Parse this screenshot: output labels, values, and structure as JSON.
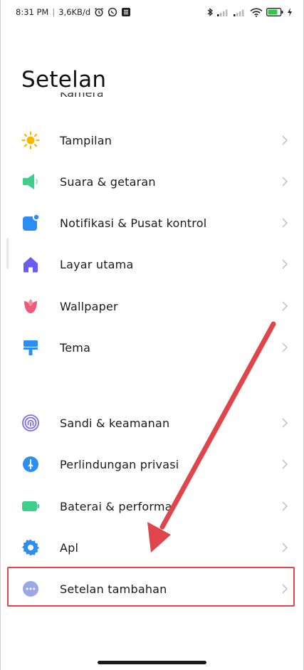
{
  "status_bar": {
    "time": "8:31 PM",
    "separator": "|",
    "speed": "3,6KB/d"
  },
  "header": {
    "title": "Setelan",
    "partial_item": "Kamera"
  },
  "settings_items": [
    {
      "label": "Tampilan",
      "icon": "sun-icon",
      "color": "#f5b800"
    },
    {
      "label": "Suara & getaran",
      "icon": "speaker-icon",
      "color": "#3ccf8e"
    },
    {
      "label": "Notifikasi & Pusat kontrol",
      "icon": "notification-icon",
      "color": "#2b8ef0"
    },
    {
      "label": "Layar utama",
      "icon": "home-icon",
      "color": "#6a5cf0"
    },
    {
      "label": "Wallpaper",
      "icon": "tulip-icon",
      "color": "#ee5a7a"
    },
    {
      "label": "Tema",
      "icon": "brush-icon",
      "color": "#2b8ef0"
    },
    {
      "label": "Sandi & keamanan",
      "icon": "fingerprint-icon",
      "color": "#7a6cf0"
    },
    {
      "label": "Perlindungan privasi",
      "icon": "shield-icon",
      "color": "#2b8ef0"
    },
    {
      "label": "Baterai & performa",
      "icon": "battery-icon",
      "color": "#3ccf8e"
    },
    {
      "label": "Apl",
      "icon": "gear-icon",
      "color": "#2b8ef0"
    },
    {
      "label": "Setelan tambahan",
      "icon": "more-dots-icon",
      "color": "#9aa8e8"
    }
  ],
  "annotation": {
    "highlight_color": "#e0454c"
  }
}
